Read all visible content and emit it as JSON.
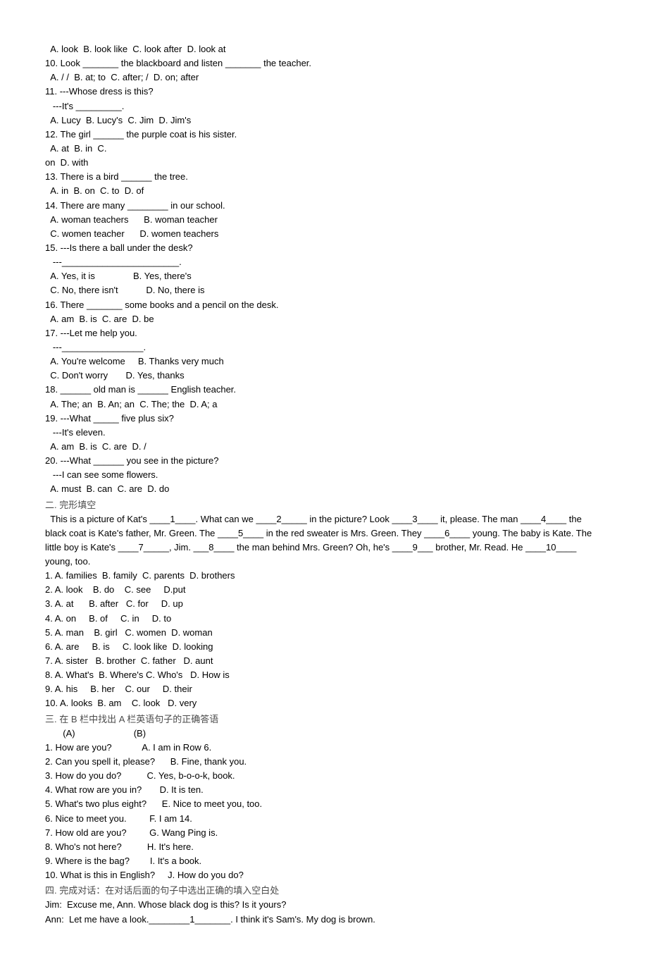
{
  "q9opts": "  A. look  B. look like  C. look after  D. look at",
  "q10": "10. Look _______ the blackboard and listen _______ the teacher.",
  "q10opts": "  A. / /  B. at; to  C. after; /  D. on; after",
  "q11a": "11. ---Whose dress is this?",
  "q11b": "   ---It's _________.",
  "q11opts": "  A. Lucy  B. Lucy's  C. Jim  D. Jim's",
  "q12": "12. The girl ______ the purple coat is his sister.",
  "q12optsA": "  A. at  B. in  C.",
  "q12optsB": "on  D. with",
  "q13": "13. There is a bird ______ the tree.",
  "q13opts": "  A. in  B. on  C. to  D. of",
  "q14": "14. There are many ________ in our school.",
  "q14optsA": "  A. woman teachers      B. woman teacher",
  "q14optsB": "  C. women teacher      D. women teachers",
  "q15a": "15. ---Is there a ball under the desk?",
  "q15b": "   ---_______________________.",
  "q15optsA": "  A. Yes, it is               B. Yes, there's",
  "q15optsB": "  C. No, there isn't           D. No, there is",
  "q16": "16. There _______ some books and a pencil on the desk.",
  "q16opts": "  A. am  B. is  C. are  D. be",
  "q17a": "17. ---Let me help you.",
  "q17b": "   ---________________.",
  "q17optsA": "  A. You're welcome     B. Thanks very much",
  "q17optsB": "  C. Don't worry       D. Yes, thanks",
  "q18": "18. ______ old man is ______ English teacher.",
  "q18opts": "  A. The; an  B. An; an  C. The; the  D. A; a",
  "q19a": "19. ---What _____ five plus six?",
  "q19b": "   ---It's eleven.",
  "q19opts": "  A. am  B. is  C. are  D. /",
  "q20a": "20. ---What ______ you see in the picture?",
  "q20b": "   ---I can see some flowers.",
  "q20opts": "  A. must  B. can  C. are  D. do",
  "sec2title": "二. 完形填空",
  "passage": "  This is a picture of Kat's ____1____. What can we ____2_____ in the picture? Look ____3____ it, please. The man ____4____ the black coat is Kate's father, Mr. Green. The ____5____ in the red sweater is Mrs. Green. They ____6____ young. The baby is Kate. The little boy is Kate's ____7_____, Jim. ___8____ the man behind Mrs. Green? Oh, he's ____9___ brother, Mr. Read. He ____10____ young, too.",
  "c1": "1. A. families  B. family  C. parents  D. brothers",
  "c2": "2. A. look    B. do    C. see     D.put",
  "c3": "3. A. at      B. after   C. for     D. up",
  "c4": "4. A. on     B. of     C. in     D. to",
  "c5": "5. A. man    B. girl   C. women  D. woman",
  "c6": "6. A. are     B. is     C. look like  D. looking",
  "c7": "7. A. sister   B. brother  C. father   D. aunt",
  "c8": "8. A. What's  B. Where's C. Who's   D. How is",
  "c9": "9. A. his     B. her    C. our     D. their",
  "c10": "10. A. looks  B. am    C. look   D. very",
  "sec3title": "三. 在 B 栏中找出 A 栏英语句子的正确答语",
  "sec3head": "       (A)                       (B)",
  "m1": "1. How are you?            A. I am in Row 6.",
  "m2": "2. Can you spell it, please?      B. Fine, thank you.",
  "m3": "3. How do you do?          C. Yes, b-o-o-k, book.",
  "m4": "4. What row are you in?       D. It is ten.",
  "m5": "5. What's two plus eight?      E. Nice to meet you, too.",
  "m6": "6. Nice to meet you.         F. I am 14.",
  "m7": "7. How old are you?         G. Wang Ping is.",
  "m8": "8. Who's not here?          H. It's here.",
  "m9": "9. Where is the bag?        I. It's a book.",
  "m10": "10. What is this in English?     J. How do you do?",
  "sec4title": "四. 完成对话：在对话后面的句子中选出正确的填入空白处",
  "d1": "Jim:  Excuse me, Ann. Whose black dog is this? Is it yours?",
  "d2": "Ann:  Let me have a look.________1_______. I think it's Sam's. My dog is brown."
}
